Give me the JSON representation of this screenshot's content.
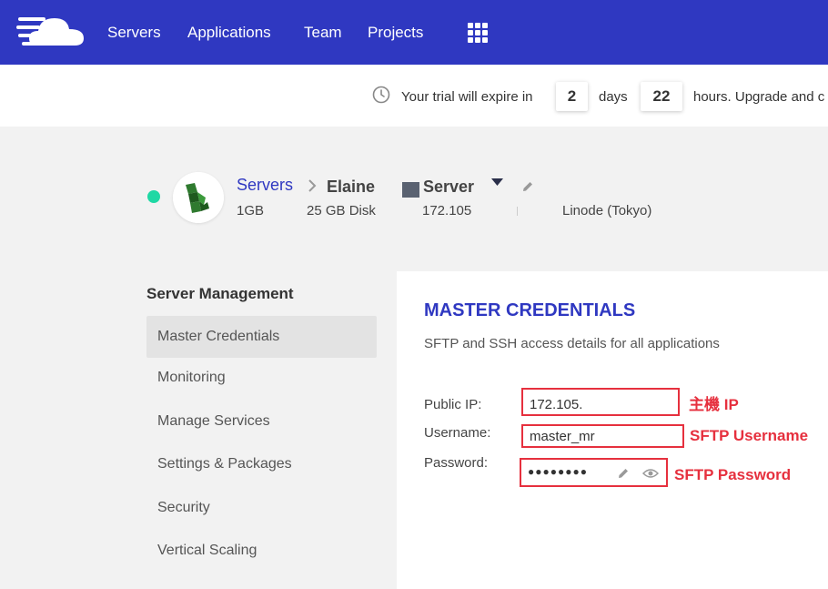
{
  "nav": {
    "logo_icon": "cloudways-cloud-logo",
    "links": [
      "Servers",
      "Applications",
      "Team",
      "Projects"
    ],
    "apps_icon": "grid-icon",
    "bg_color": "#2f38c1"
  },
  "trial": {
    "icon": "clock-icon",
    "prefix": "Your trial will expire in",
    "days": "2",
    "days_label": "days",
    "hours": "22",
    "hours_label": "hours. Upgrade and c"
  },
  "server": {
    "status_color": "#1fd8a4",
    "breadcrumb_servers": "Servers",
    "name": "Elaine",
    "type_label": "Server",
    "size": "1GB",
    "disk": "25 GB Disk",
    "ip": "172.105",
    "provider": "Linode (Tokyo)"
  },
  "sidebar": {
    "title": "Server Management",
    "items": [
      {
        "label": "Master Credentials",
        "active": true
      },
      {
        "label": "Monitoring",
        "active": false
      },
      {
        "label": "Manage Services",
        "active": false
      },
      {
        "label": "Settings & Packages",
        "active": false
      },
      {
        "label": "Security",
        "active": false
      },
      {
        "label": "Vertical Scaling",
        "active": false
      }
    ]
  },
  "credentials": {
    "title": "MASTER CREDENTIALS",
    "subtitle": "SFTP and SSH access details for all applications",
    "public_ip_label": "Public IP:",
    "public_ip_value": "172.105.",
    "username_label": "Username:",
    "username_value": "master_mr",
    "password_label": "Password:",
    "password_value": "●●●●●●●●",
    "annotation_ip": "主機 IP",
    "annotation_username": "SFTP Username",
    "annotation_password": "SFTP Password",
    "annotation_color": "#e6303e"
  }
}
